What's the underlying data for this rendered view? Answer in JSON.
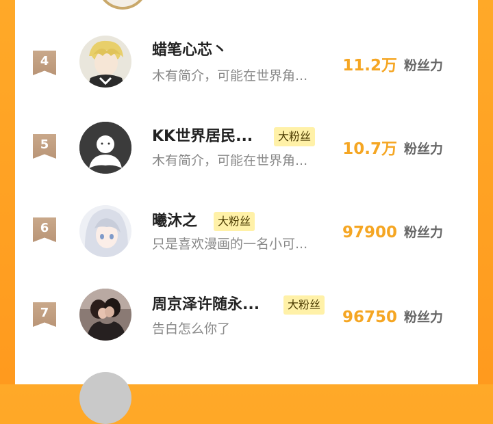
{
  "colors": {
    "background": "#ffa928",
    "card": "#ffffff",
    "rank_badge": "#c9a88a",
    "fans_value": "#f5a623",
    "fan_badge_bg": "#fff1a8"
  },
  "fans_suffix": "粉丝力",
  "rows": [
    {
      "rank": "4",
      "name": "蜡笔心芯丶",
      "badge": "",
      "bio": "木有简介，可能在世界角...",
      "fans": "11.2万",
      "avatar_icon": "anime-boy-avatar"
    },
    {
      "rank": "5",
      "name": "KK世界居民...",
      "badge": "大粉丝",
      "bio": "木有简介，可能在世界角...",
      "fans": "10.7万",
      "avatar_icon": "default-user-avatar"
    },
    {
      "rank": "6",
      "name": "曦沐之",
      "badge": "大粉丝",
      "bio": "只是喜欢漫画的一名小可...",
      "fans": "97900",
      "avatar_icon": "anime-girl-avatar"
    },
    {
      "rank": "7",
      "name": "周京泽许随永...",
      "badge": "大粉丝",
      "bio": "告白怎么你了",
      "fans": "96750",
      "avatar_icon": "couple-photo-avatar"
    }
  ]
}
